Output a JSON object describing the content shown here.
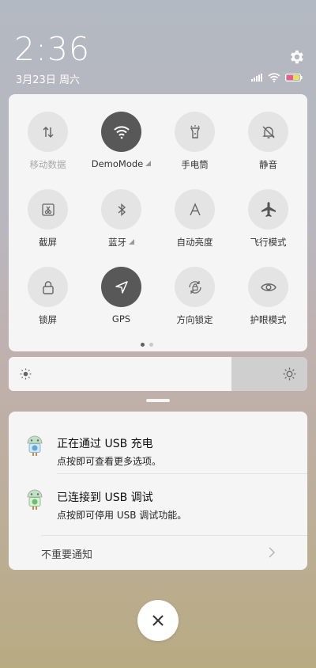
{
  "status_bar": {
    "time": "2:36",
    "date": "3月23日 周六",
    "settings_icon": "gear-icon",
    "signal_icon": "cellular-signal-icon",
    "wifi_icon": "wifi-icon",
    "battery_icon": "battery-icon"
  },
  "quick_settings": {
    "page_indicator": {
      "pages": 2,
      "current": 1
    },
    "tiles": [
      {
        "label": "移动数据",
        "icon": "mobile-data-icon",
        "active": false,
        "disabled": true
      },
      {
        "label": "DemoMode",
        "icon": "wifi-icon",
        "active": true,
        "has_expand": true
      },
      {
        "label": "手电筒",
        "icon": "flashlight-icon",
        "active": false
      },
      {
        "label": "静音",
        "icon": "mute-bell-icon",
        "active": false
      },
      {
        "label": "截屏",
        "icon": "screenshot-icon",
        "active": false
      },
      {
        "label": "蓝牙",
        "icon": "bluetooth-icon",
        "active": false,
        "has_expand": true
      },
      {
        "label": "自动亮度",
        "icon": "auto-brightness-icon",
        "active": false
      },
      {
        "label": "飞行模式",
        "icon": "airplane-icon",
        "active": false
      },
      {
        "label": "锁屏",
        "icon": "lock-icon",
        "active": false
      },
      {
        "label": "GPS",
        "icon": "location-arrow-icon",
        "active": true
      },
      {
        "label": "方向锁定",
        "icon": "rotation-lock-icon",
        "active": false
      },
      {
        "label": "护眼模式",
        "icon": "eye-icon",
        "active": false
      }
    ]
  },
  "brightness": {
    "level": 0.745,
    "low_icon": "brightness-low-icon",
    "high_icon": "brightness-high-icon"
  },
  "notifications": {
    "items": [
      {
        "title": "正在通过 USB 充电",
        "subtitle": "点按即可查看更多选项。",
        "icon": "android-usb-icon"
      },
      {
        "title": "已连接到 USB 调试",
        "subtitle": "点按即可停用 USB 调试功能。",
        "icon": "android-debug-icon"
      }
    ],
    "unimportant_label": "不重要通知"
  },
  "colors": {
    "active_tile": "#585858",
    "inactive_tile": "#e4e4e4",
    "panel_bg": "#f5f5f5"
  }
}
